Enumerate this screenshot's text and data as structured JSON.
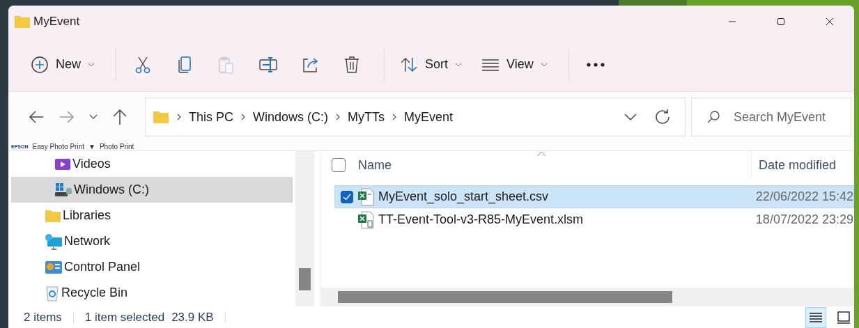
{
  "window": {
    "title": "MyEvent"
  },
  "toolbar": {
    "items": [
      {
        "kind": "new",
        "label": "New",
        "has_menu": true,
        "disabled": false
      },
      {
        "kind": "cut",
        "disabled": false
      },
      {
        "kind": "copy",
        "disabled": false
      },
      {
        "kind": "paste",
        "disabled": true
      },
      {
        "kind": "rename",
        "disabled": false
      },
      {
        "kind": "share",
        "disabled": false
      },
      {
        "kind": "delete",
        "disabled": false
      },
      {
        "kind": "sort",
        "label": "Sort",
        "has_menu": true,
        "disabled": false
      },
      {
        "kind": "view",
        "label": "View",
        "has_menu": true,
        "disabled": false
      },
      {
        "kind": "more",
        "disabled": false
      }
    ]
  },
  "navigation": {
    "back_disabled": false,
    "forward_disabled": true
  },
  "breadcrumb": [
    "This PC",
    "Windows (C:)",
    "MyTTs",
    "MyEvent"
  ],
  "search": {
    "placeholder": "Search MyEvent"
  },
  "epson_bar": {
    "brand": "EPSON",
    "items": [
      "Easy Photo Print",
      "▼",
      "Photo Print"
    ]
  },
  "nav_pane": {
    "items": [
      {
        "kind": "videos",
        "label": "Videos",
        "nested": true,
        "selected": false
      },
      {
        "kind": "drive",
        "label": "Windows (C:)",
        "nested": true,
        "selected": true
      },
      {
        "kind": "libraries",
        "label": "Libraries",
        "nested": false,
        "selected": false
      },
      {
        "kind": "network",
        "label": "Network",
        "nested": false,
        "selected": false
      },
      {
        "kind": "control",
        "label": "Control Panel",
        "nested": false,
        "selected": false
      },
      {
        "kind": "recycle",
        "label": "Recycle Bin",
        "nested": false,
        "selected": false
      }
    ]
  },
  "table": {
    "columns": [
      "Name",
      "Date modified"
    ],
    "select_all": {
      "checked": false
    },
    "rows": [
      {
        "kind": "csv",
        "name": "MyEvent_solo_start_sheet.csv",
        "date": "22/06/2022 15:42",
        "selected": true
      },
      {
        "kind": "xlsm",
        "name": "TT-Event-Tool-v3-R85-MyEvent.xlsm",
        "date": "18/07/2022 23:29",
        "selected": false
      }
    ]
  },
  "status_bar": {
    "count": "2 items",
    "selection": "1 item selected",
    "size": "23.9 KB"
  },
  "view_toggles": [
    {
      "kind": "details",
      "selected": true
    },
    {
      "kind": "tiles",
      "selected": false
    }
  ]
}
